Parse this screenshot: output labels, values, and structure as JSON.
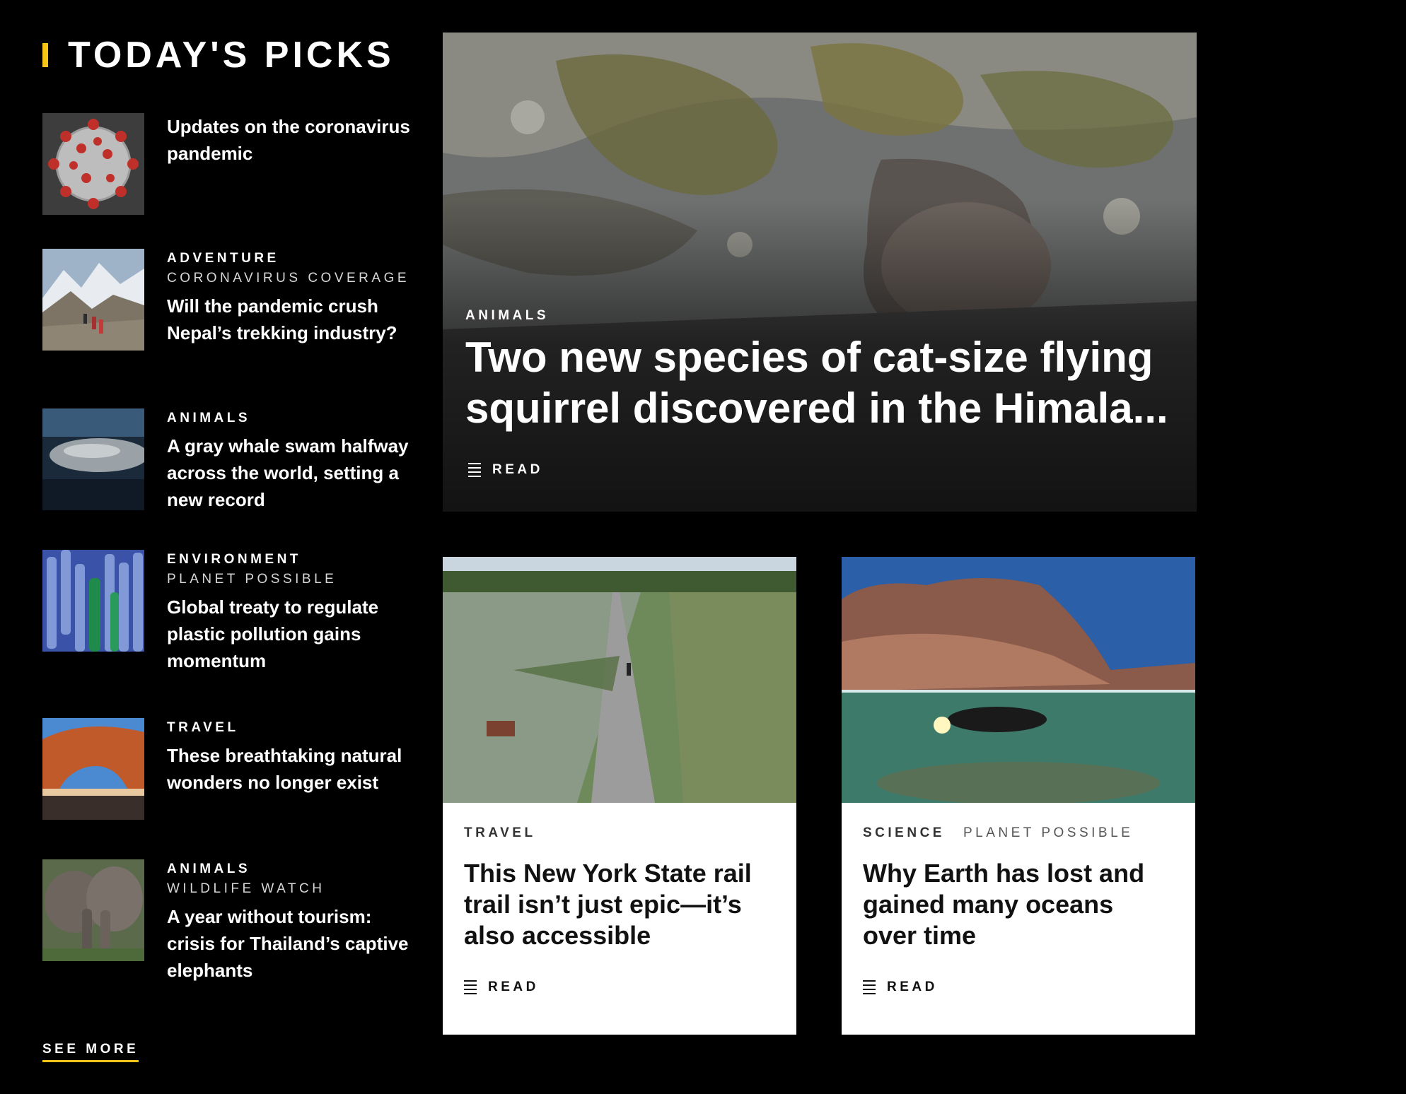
{
  "colors": {
    "accent": "#f5c518",
    "background": "#000000",
    "card_bg": "#ffffff"
  },
  "todays_picks": {
    "title": "TODAY'S PICKS",
    "items": [
      {
        "category": "",
        "subcategory": "",
        "title": "Updates on the coronavirus pandemic",
        "thumb": "coronavirus-image"
      },
      {
        "category": "ADVENTURE",
        "subcategory": "CORONAVIRUS COVERAGE",
        "title": "Will the pandemic crush Nepal’s trekking industry?",
        "thumb": "mountain-trekkers-image"
      },
      {
        "category": "ANIMALS",
        "subcategory": "",
        "title": "A gray whale swam halfway across the world, setting a new record",
        "thumb": "gray-whale-image"
      },
      {
        "category": "ENVIRONMENT",
        "subcategory": "PLANET POSSIBLE",
        "title": "Global treaty to regulate plastic pollution gains momentum",
        "thumb": "plastic-bottles-image"
      },
      {
        "category": "TRAVEL",
        "subcategory": "",
        "title": "These breathtaking natural wonders no longer exist",
        "thumb": "rock-arch-image"
      },
      {
        "category": "ANIMALS",
        "subcategory": "WILDLIFE WATCH",
        "title": "A year without tourism: crisis for Thailand’s captive elephants",
        "thumb": "elephants-image"
      }
    ],
    "see_more": "SEE MORE"
  },
  "hero": {
    "category": "ANIMALS",
    "title": "Two new species of cat-size flying squirrel discovered in the Himala...",
    "read_label": "READ",
    "image": "flying-squirrel-on-rock-image"
  },
  "cards": [
    {
      "category": "TRAVEL",
      "subcategory": "",
      "title": "This New York State rail trail isn’t just epic—it’s also accessible",
      "read_label": "READ",
      "image": "rail-trail-aerial-image"
    },
    {
      "category": "SCIENCE",
      "subcategory": "PLANET POSSIBLE",
      "title": "Why Earth has lost and gained many oceans over time",
      "read_label": "READ",
      "image": "diver-under-cliff-image"
    }
  ]
}
